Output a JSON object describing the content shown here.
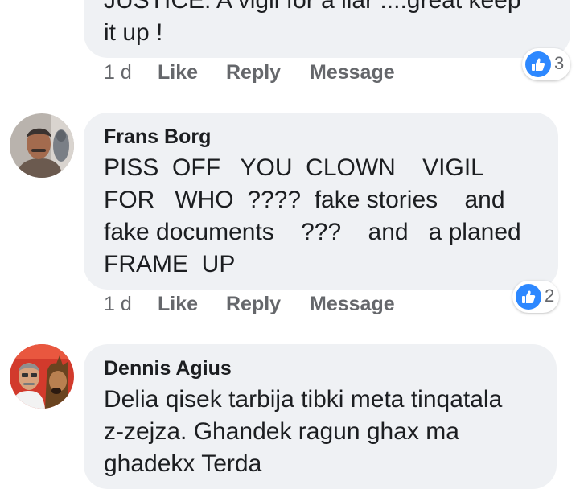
{
  "comments": [
    {
      "author": "",
      "lines": [
        "JUSTICE. A vigil for a liar ....great keep",
        "it up !"
      ],
      "time": "1 d",
      "like_label": "Like",
      "reply_label": "Reply",
      "message_label": "Message",
      "reaction_icon": "like-icon",
      "reaction_count": "3"
    },
    {
      "author": "Frans Borg",
      "lines": [
        "PISS  OFF   YOU  CLOWN    VIGIL",
        "FOR   WHO  ????  fake stories    and",
        "fake documents    ???    and   a planed",
        "FRAME  UP"
      ],
      "time": "1 d",
      "like_label": "Like",
      "reply_label": "Reply",
      "message_label": "Message",
      "reaction_icon": "like-icon",
      "reaction_count": "2"
    },
    {
      "author": "Dennis Agius",
      "lines": [
        "Delia qisek tarbija tibki meta tinqatala",
        "z-zejza. Ghandek ragun ghax ma",
        "ghadekx Terda"
      ],
      "time": "",
      "like_label": "",
      "reply_label": "",
      "message_label": "",
      "reaction_icon": "",
      "reaction_count": ""
    }
  ],
  "colors": {
    "bubble": "#eff1f4",
    "action_text": "#65676b",
    "like_blue": "#2d88ff"
  }
}
